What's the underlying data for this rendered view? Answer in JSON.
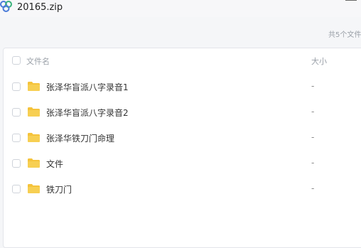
{
  "window": {
    "title": "20165.zip"
  },
  "summary": "共5个文件",
  "columns": {
    "name": "文件名",
    "size": "大小"
  },
  "items": [
    {
      "name": "张泽华盲派八字录音1",
      "size": "-"
    },
    {
      "name": "张泽华盲派八字录音2",
      "size": "-"
    },
    {
      "name": "张泽华铁刀门命理",
      "size": "-"
    },
    {
      "name": "文件",
      "size": "-"
    },
    {
      "name": "铁刀门",
      "size": "-"
    }
  ],
  "icons": {
    "app": "archive-logo-icon",
    "folder": "folder-icon"
  },
  "colors": {
    "folder": "#f5c33b",
    "brand_blue": "#4a7bd8",
    "brand_green": "#39b27a"
  }
}
